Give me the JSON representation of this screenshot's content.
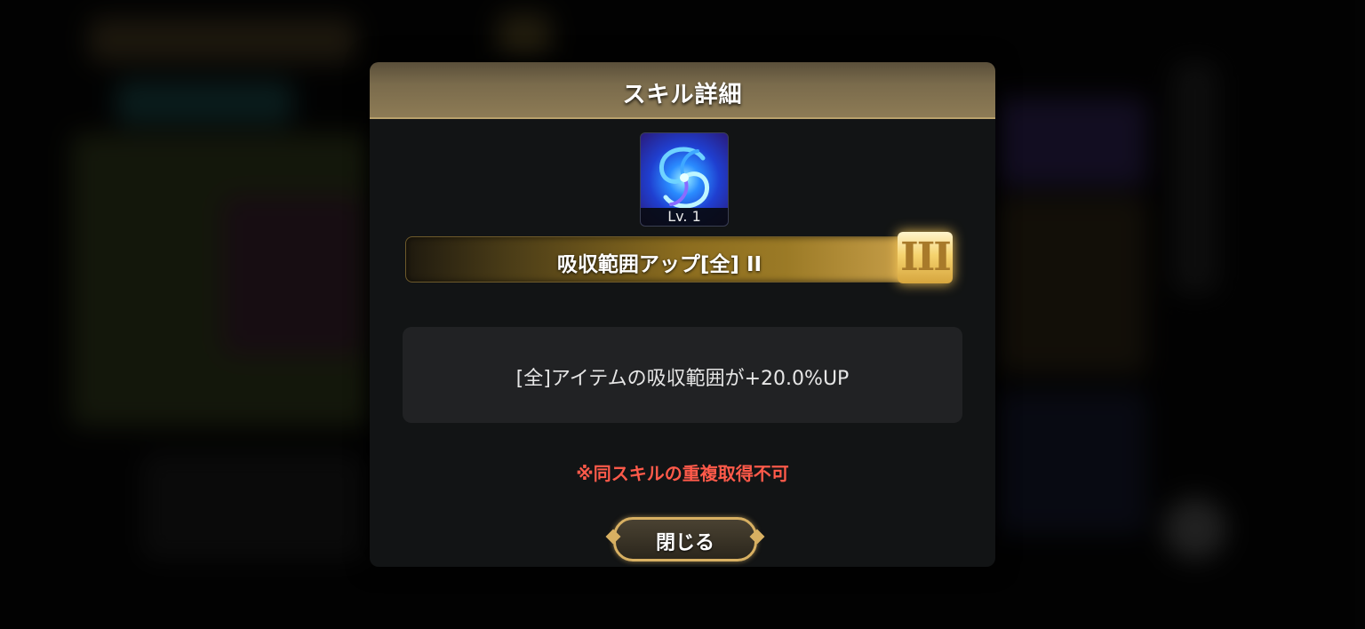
{
  "dialog": {
    "title": "スキル詳細"
  },
  "skill": {
    "icon": "blue-vortex-icon",
    "level": "Lv. 1",
    "name": "吸収範囲アップ[全] II",
    "rank": "III",
    "description": "[全]アイテムの吸収範囲が+20.0%UP"
  },
  "notice": "※同スキルの重複取得不可",
  "buttons": {
    "close_label": "閉じる"
  },
  "colors": {
    "header": "#7a6b4c",
    "gold_accent": "#d8b062",
    "warning": "#ff5a4a",
    "panel": "#121415"
  }
}
